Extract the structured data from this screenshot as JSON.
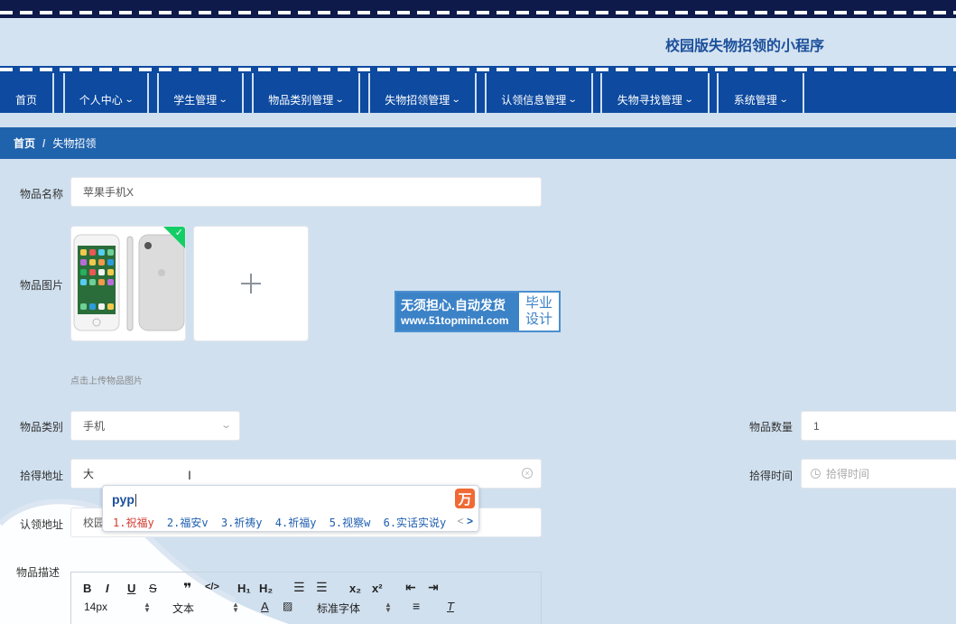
{
  "app": {
    "title": "校园版失物招领的小程序"
  },
  "nav": {
    "items": [
      {
        "label": "首页",
        "chevron": false
      },
      {
        "label": "个人中心",
        "chevron": true
      },
      {
        "label": "学生管理",
        "chevron": true
      },
      {
        "label": "物品类别管理",
        "chevron": true
      },
      {
        "label": "失物招领管理",
        "chevron": true
      },
      {
        "label": "认领信息管理",
        "chevron": true
      },
      {
        "label": "失物寻找管理",
        "chevron": true
      },
      {
        "label": "系统管理",
        "chevron": true
      }
    ]
  },
  "breadcrumb": {
    "home": "首页",
    "separator": "/",
    "current": "失物招领"
  },
  "form": {
    "item_name_label": "物品名称",
    "item_name_value": "苹果手机X",
    "item_image_label": "物品图片",
    "upload_hint": "点击上传物品图片",
    "category_label": "物品类别",
    "category_value": "手机",
    "quantity_label": "物品数量",
    "quantity_value": "1",
    "found_address_label": "拾得地址",
    "found_address_value": "大",
    "found_time_label": "拾得时间",
    "found_time_placeholder": "拾得时间",
    "claim_address_label": "认领地址",
    "claim_address_value": "校园",
    "description_label": "物品描述"
  },
  "watermark": {
    "line1": "无须担心.自动发货",
    "line2": "www.51topmind.com",
    "side1": "毕业",
    "side2": "设计"
  },
  "ime": {
    "input": "pyp",
    "logo": "万",
    "candidates": [
      "1.祝福y",
      "2.福安v",
      "3.祈祷y",
      "4.祈福y",
      "5.视察w",
      "6.实话实说y"
    ],
    "prev": "<",
    "next": ">"
  },
  "editor": {
    "font_size": "14px",
    "paragraph": "文本",
    "font_family": "标准字体"
  },
  "colors": {
    "nav_bg": "#0d4aa0",
    "crumb_bg": "#2063ad",
    "page_bg": "#d0e0ef",
    "title": "#1b4f9b"
  }
}
